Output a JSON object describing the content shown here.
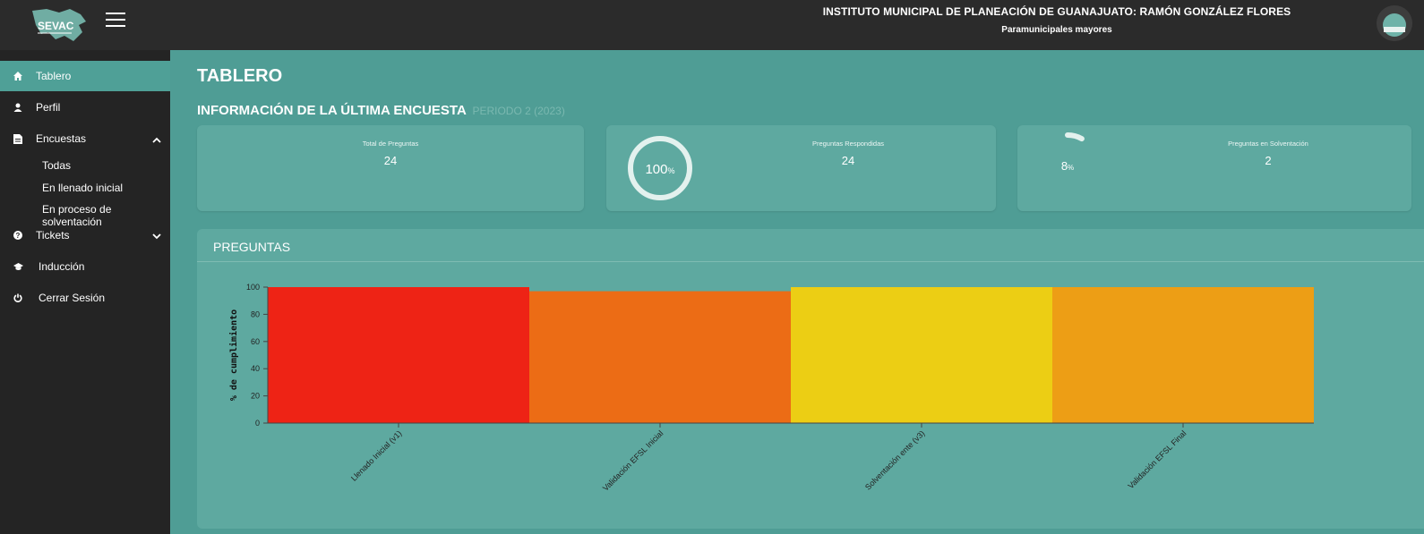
{
  "header": {
    "logo_text": "SEVAC",
    "organization": "INSTITUTO MUNICIPAL DE PLANEACIÓN DE GUANAJUATO: RAMÓN GONZÁLEZ FLORES",
    "entity_type": "Paramunicipales mayores"
  },
  "sidebar": {
    "items": [
      {
        "label": "Tablero",
        "icon": "home-icon",
        "active": true
      },
      {
        "label": "Perfil",
        "icon": "user-icon"
      },
      {
        "label": "Encuestas",
        "icon": "document-icon",
        "expanded": true
      },
      {
        "label": "Tickets",
        "icon": "question-icon",
        "expanded": false
      },
      {
        "label": "Inducción",
        "icon": "graduation-cap-icon"
      },
      {
        "label": "Cerrar Sesión",
        "icon": "power-icon"
      }
    ],
    "encuestas_sub": [
      "Todas",
      "En llenado inicial",
      "En proceso de solventación"
    ]
  },
  "main": {
    "page_title": "TABLERO",
    "section_title": "INFORMACIÓN DE LA ÚLTIMA ENCUESTA",
    "period": "PERIODO 2 (2023)",
    "cards": [
      {
        "label": "Total de Preguntas",
        "value": "24"
      },
      {
        "label": "Preguntas Respondidas",
        "value": "24",
        "percent": "100",
        "fraction": 1.0
      },
      {
        "label": "Preguntas en Solventación",
        "value": "2",
        "percent": "8",
        "fraction": 0.08
      }
    ],
    "panel_title": "PREGUNTAS"
  },
  "colors": {
    "topbar": "#2b2b2b",
    "sidebar": "#242424",
    "accent": "#4fa097",
    "main_bg": "#4f9d95",
    "card_bg": "#5ea9a0"
  },
  "chart_data": {
    "type": "bar",
    "ylabel": "% de cumplimiento",
    "categories": [
      "Llenado Inicial (v1)",
      "Validación EFSL Inicial",
      "Solventación ente (v3)",
      "Validación EFSL Final"
    ],
    "values": [
      100,
      97,
      100,
      100
    ],
    "colors": [
      "#ee2315",
      "#ec6c15",
      "#ecce14",
      "#ed9e15"
    ],
    "ylim": [
      0,
      100
    ],
    "yticks": [
      0,
      20,
      40,
      60,
      80,
      100
    ]
  }
}
